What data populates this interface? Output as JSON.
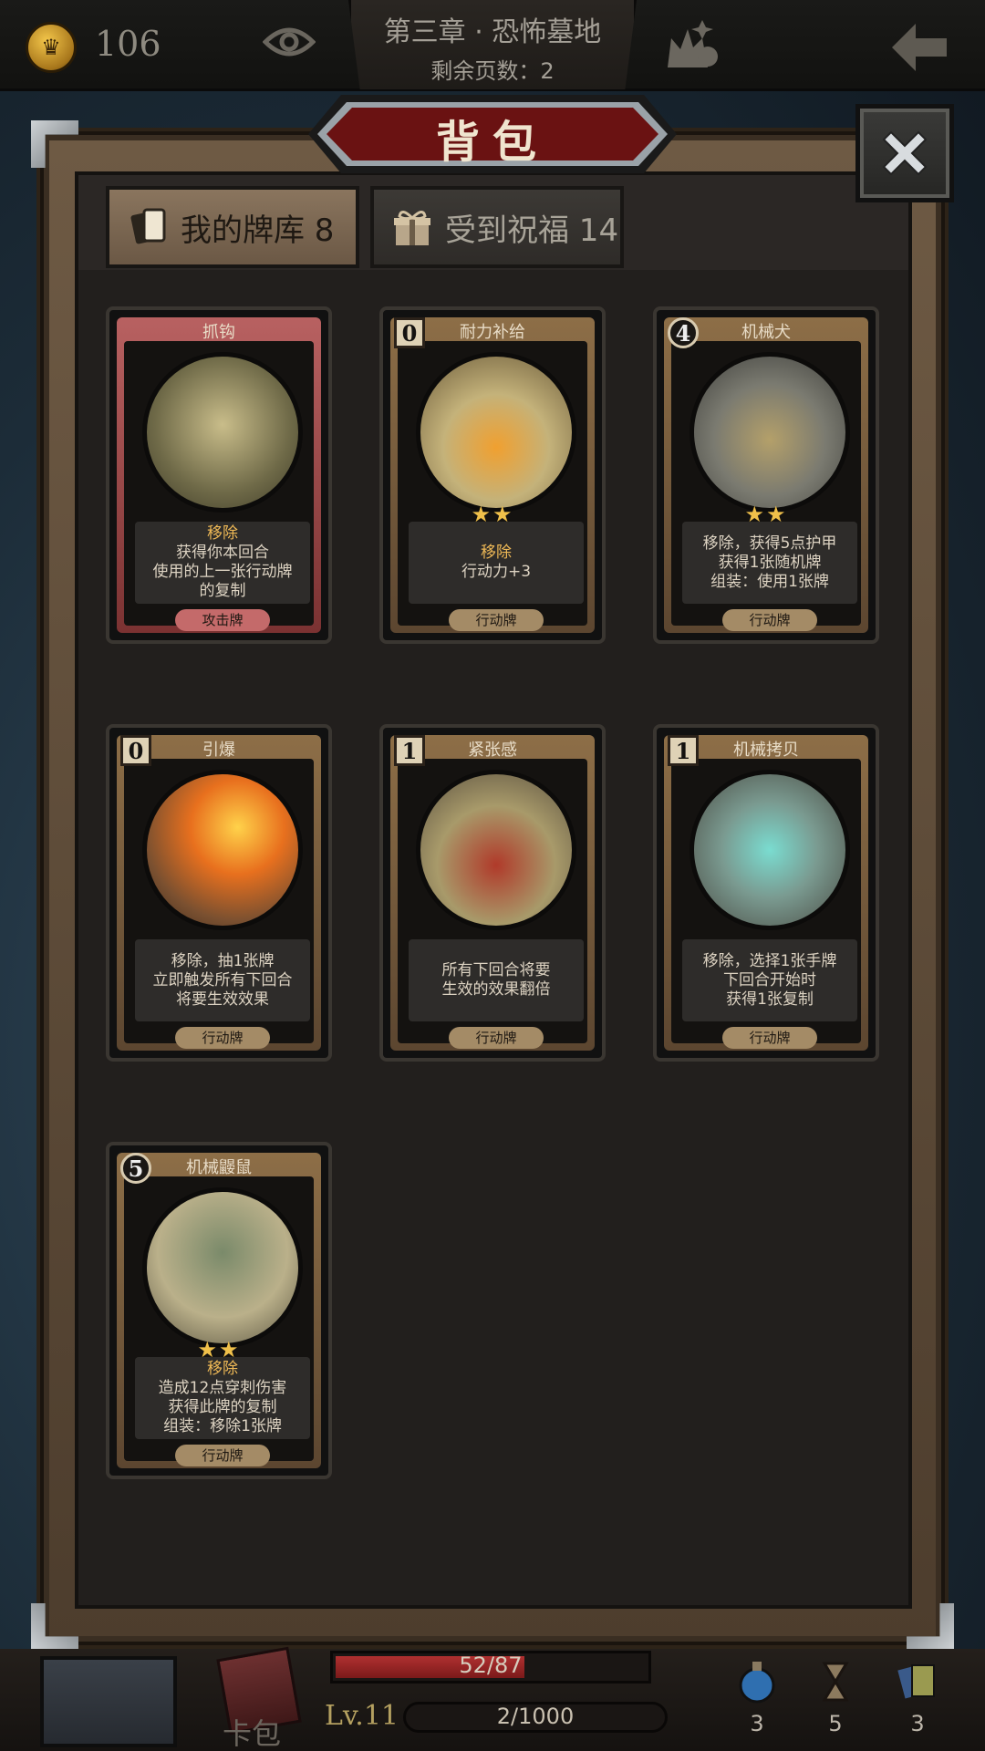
{
  "header": {
    "gold": "106",
    "chapter": "第三章 · 恐怖墓地",
    "pages_remaining": "剩余页数：2"
  },
  "panel": {
    "title": "背包",
    "tabs": [
      {
        "label": "我的牌库 8",
        "active": true
      },
      {
        "label": "受到祝福 14",
        "active": false
      }
    ]
  },
  "cards": [
    {
      "name": "抓钩",
      "cost": "",
      "stars": "",
      "desc": [
        "移除",
        "获得你本回合",
        "使用的上一张行动牌",
        "的复制"
      ],
      "type": "攻击牌"
    },
    {
      "name": "耐力补给",
      "cost": "0",
      "stars": "★★",
      "desc": [
        "移除",
        "行动力+3"
      ],
      "type": "行动牌"
    },
    {
      "name": "机械犬",
      "cost": "4",
      "stars": "★★",
      "desc": [
        "移除，获得5点护甲",
        "获得1张随机牌",
        "组装：使用1张牌"
      ],
      "type": "行动牌"
    },
    {
      "name": "引爆",
      "cost": "0",
      "stars": "",
      "desc": [
        "移除，抽1张牌",
        "立即触发所有下回合",
        "将要生效效果"
      ],
      "type": "行动牌"
    },
    {
      "name": "紧张感",
      "cost": "1",
      "stars": "",
      "desc": [
        "所有下回合将要",
        "生效的效果翻倍"
      ],
      "type": "行动牌"
    },
    {
      "name": "机械拷贝",
      "cost": "1",
      "stars": "",
      "desc": [
        "移除，选择1张手牌",
        "下回合开始时",
        "获得1张复制"
      ],
      "type": "行动牌"
    },
    {
      "name": "机械鼹鼠",
      "cost": "5",
      "stars": "★★",
      "desc": [
        "移除",
        "造成12点穿刺伤害",
        "获得此牌的复制",
        "组装：移除1张牌"
      ],
      "type": "行动牌"
    }
  ],
  "footer": {
    "card_pack_label": "卡包",
    "hp_text": "52/87",
    "hp_fraction": 0.598,
    "level": "Lv.11",
    "xp_text": "2/1000",
    "resources": [
      {
        "icon": "blue-potion-icon",
        "value": "3"
      },
      {
        "icon": "hourglass-icon",
        "value": "5"
      },
      {
        "icon": "cards-icon",
        "value": "3"
      }
    ]
  }
}
